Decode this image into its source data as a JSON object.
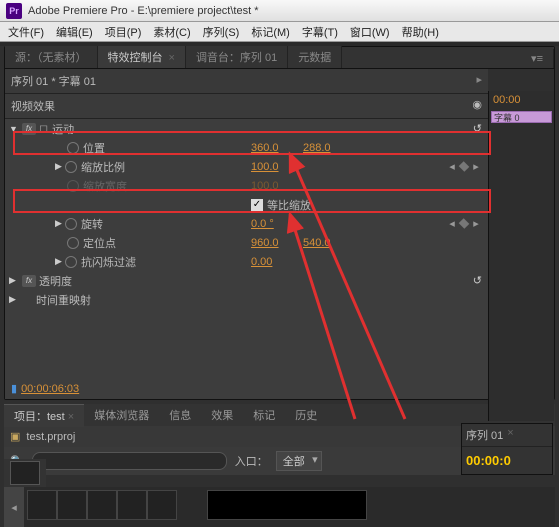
{
  "titlebar": {
    "icon": "Pr",
    "title": "Adobe Premiere Pro - E:\\premiere project\\test *"
  },
  "menubar": [
    "文件(F)",
    "编辑(E)",
    "项目(P)",
    "素材(C)",
    "序列(S)",
    "标记(M)",
    "字幕(T)",
    "窗口(W)",
    "帮助(H)"
  ],
  "tabs": {
    "source": "源：（无素材）",
    "effect": "特效控制台",
    "mixer": "调音台：序列 01",
    "meta": "元数据"
  },
  "seq_title": "序列 01 * 字幕 01",
  "eff_section": "视频效果",
  "timecode_top": "00:00",
  "clip_name": "字幕 0",
  "motion": {
    "label": "运动",
    "position": {
      "label": "位置",
      "x": "360.0",
      "y": "288.0"
    },
    "scale": {
      "label": "缩放比例",
      "val": "100.0"
    },
    "scalew": {
      "label": "缩放宽度",
      "val": "100.0"
    },
    "uniform": {
      "label": "等比缩放"
    },
    "rotation": {
      "label": "旋转",
      "val": "0.0 °"
    },
    "anchor": {
      "label": "定位点",
      "x": "960.0",
      "y": "540.0"
    },
    "flicker": {
      "label": "抗闪烁过滤",
      "val": "0.00"
    }
  },
  "opacity": {
    "label": "透明度"
  },
  "timeremap": {
    "label": "时间重映射"
  },
  "timecode_bottom": "00:00:06:03",
  "proj_tabs": [
    "项目：test",
    "媒体浏览器",
    "信息",
    "效果",
    "标记",
    "历史"
  ],
  "proj_item": "test.prproj",
  "search_placeholder": "",
  "inpoint_label": "入口：",
  "inpoint_value": "全部",
  "seq_panel": {
    "title": "序列 01",
    "tc": "00:00:0"
  }
}
